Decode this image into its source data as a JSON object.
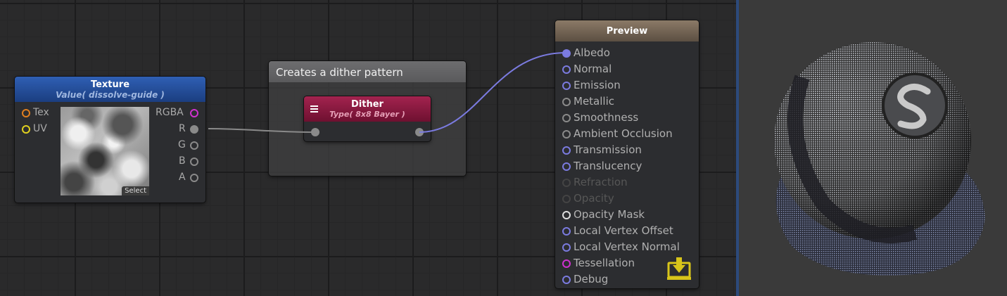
{
  "texture_node": {
    "title": "Texture",
    "subtitle": "Value( dissolve-guide )",
    "inputs": [
      "Tex",
      "UV"
    ],
    "outputs": [
      "RGBA",
      "R",
      "G",
      "B",
      "A"
    ],
    "select_label": "Select"
  },
  "comment_box": {
    "title": "Creates a dither pattern"
  },
  "dither_node": {
    "title": "Dither",
    "subtitle": "Type( 8x8 Bayer )",
    "icon": "menu-icon"
  },
  "output_node": {
    "title": "Preview",
    "ports": [
      {
        "label": "Albedo",
        "color": "#7b7be0",
        "filled": true,
        "dim": false
      },
      {
        "label": "Normal",
        "color": "#7b7be0",
        "filled": false,
        "dim": false
      },
      {
        "label": "Emission",
        "color": "#7b7be0",
        "filled": false,
        "dim": false
      },
      {
        "label": "Metallic",
        "color": "#8a8a8a",
        "filled": false,
        "dim": false
      },
      {
        "label": "Smoothness",
        "color": "#8a8a8a",
        "filled": false,
        "dim": false
      },
      {
        "label": "Ambient Occlusion",
        "color": "#8a8a8a",
        "filled": false,
        "dim": false
      },
      {
        "label": "Transmission",
        "color": "#7b7be0",
        "filled": false,
        "dim": false
      },
      {
        "label": "Translucency",
        "color": "#7b7be0",
        "filled": false,
        "dim": false
      },
      {
        "label": "Refraction",
        "color": "#444444",
        "filled": false,
        "dim": true
      },
      {
        "label": "Opacity",
        "color": "#444444",
        "filled": false,
        "dim": true
      },
      {
        "label": "Opacity Mask",
        "color": "#dddddd",
        "filled": false,
        "dim": false
      },
      {
        "label": "Local Vertex Offset",
        "color": "#7b7be0",
        "filled": false,
        "dim": false
      },
      {
        "label": "Local Vertex Normal",
        "color": "#7b7be0",
        "filled": false,
        "dim": false
      },
      {
        "label": "Tessellation",
        "color": "#d030d0",
        "filled": false,
        "dim": false
      },
      {
        "label": "Debug",
        "color": "#7b7be0",
        "filled": false,
        "dim": false
      }
    ],
    "save_icon": "save-icon"
  },
  "colors": {
    "texture_header": "#2f5fb4",
    "dither_header": "#a3234f",
    "output_header": "#8b7a67",
    "wire_gray": "#8a8a8a",
    "wire_blue": "#7b7be0",
    "save_icon": "#d8c51a"
  }
}
